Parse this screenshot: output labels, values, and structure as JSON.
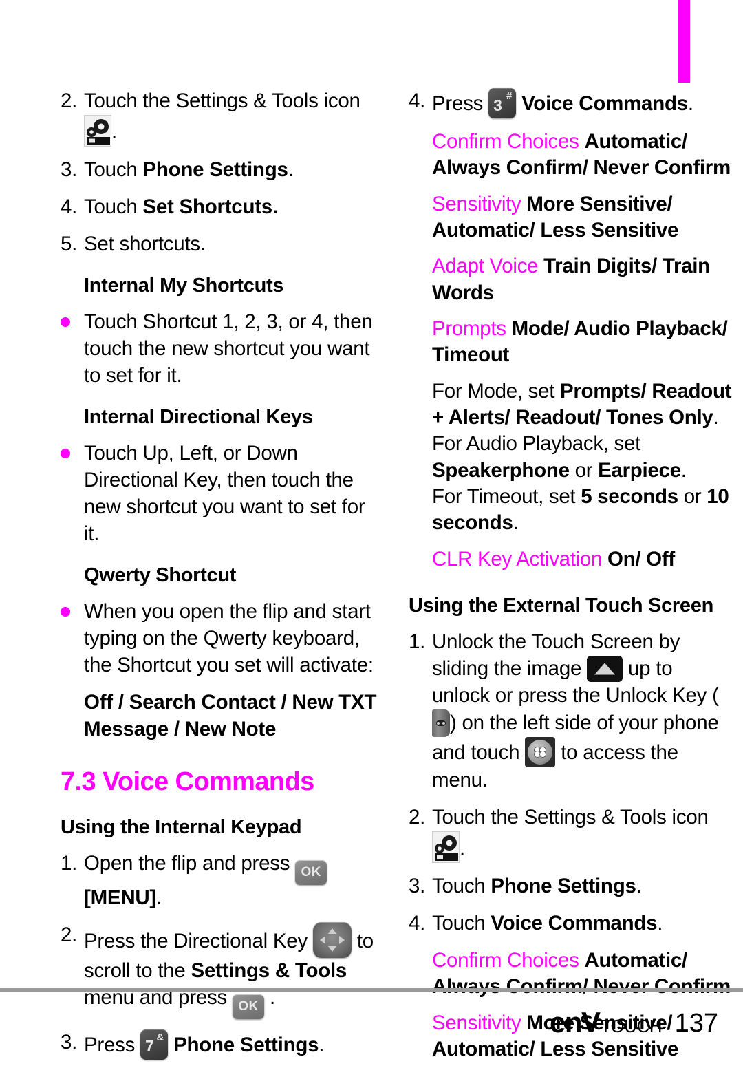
{
  "page": {
    "number": "137",
    "brand_primary": "enV",
    "brand_secondary": "TOUCH",
    "accent_color": "#FF00FF",
    "rule_color": "#9B9B9B"
  },
  "left_column": {
    "steps_top": [
      {
        "num": "2.",
        "pre": "Touch the Settings & Tools icon ",
        "icon": "settings-tools-icon",
        "post": "."
      },
      {
        "num": "3.",
        "pre": "Touch ",
        "bold": "Phone Settings",
        "post": "."
      },
      {
        "num": "4.",
        "pre": "Touch ",
        "bold": "Set Shortcuts.",
        "post": ""
      },
      {
        "num": "5.",
        "pre": "Set shortcuts.",
        "bold": "",
        "post": ""
      }
    ],
    "heading_internal_my_shortcuts": "Internal My Shortcuts",
    "bullet_my_shortcuts": "Touch Shortcut 1, 2, 3, or 4, then touch the new shortcut you want to set for it.",
    "heading_internal_directional_keys": "Internal Directional Keys",
    "bullet_directional_keys": "Touch Up, Left, or Down Directional Key, then touch the new shortcut you want to set for it.",
    "heading_qwerty_shortcut": "Qwerty Shortcut",
    "bullet_qwerty": "When you open the flip and start typing on the Qwerty keyboard, the Shortcut you set will activate:",
    "qwerty_options": "Off / Search Contact / New TXT Message / New Note",
    "section_heading": "7.3 Voice Commands",
    "heading_internal_keypad": "Using the Internal Keypad",
    "keypad_steps": [
      {
        "num": "1.",
        "pre": "Open the flip and press ",
        "icon": "ok-key-icon",
        "post_bold": "[MENU]",
        "post": "."
      },
      {
        "num": "2.",
        "pre": "Press the Directional Key ",
        "icon": "directional-key-icon",
        "mid": " to scroll to the ",
        "bold": "Settings & Tools",
        "mid2": " menu and press ",
        "icon2": "ok-key-icon",
        "post": " ."
      },
      {
        "num": "3.",
        "pre": "Press ",
        "icon": "key-7-icon",
        "key_digit": "7",
        "key_symbol": "&",
        "bold": "Phone Settings",
        "post": "."
      }
    ]
  },
  "right_column": {
    "step_4": {
      "num": "4.",
      "pre": "Press ",
      "key_digit": "3",
      "key_symbol": "#",
      "bold": "Voice Commands",
      "post": "."
    },
    "options": [
      {
        "key": "Confirm Choices",
        "value": "Automatic/ Always Confirm/ Never Confirm"
      },
      {
        "key": "Sensitivity",
        "value": "More Sensitive/ Automatic/ Less Sensitive"
      },
      {
        "key": "Adapt Voice",
        "value": "Train Digits/ Train Words"
      },
      {
        "key": "Prompts",
        "value": "Mode/ Audio Playback/ Timeout"
      }
    ],
    "prompt_detail": [
      {
        "pre": "For Mode, set ",
        "bold": "Prompts/ Readout + Alerts/ Readout/ Tones Only",
        "post": "."
      },
      {
        "pre": "For Audio Playback, set ",
        "bold": "Speakerphone",
        "mid": " or ",
        "bold2": "Earpiece",
        "post": "."
      },
      {
        "pre": "For Timeout, set ",
        "bold": "5 seconds",
        "mid": " or ",
        "bold2": "10 seconds",
        "post": "."
      }
    ],
    "clr_option": {
      "key": "CLR Key Activation",
      "value": "On/ Off"
    },
    "heading_external_touch": "Using the External Touch Screen",
    "touch_steps": [
      {
        "num": "1.",
        "t1": "Unlock the Touch Screen by sliding the image ",
        "icon1": "unlock-slider-icon",
        "t2": " up to unlock or press the Unlock Key (",
        "icon2": "unlock-key-icon",
        "t3": ") on the left side of your phone and touch ",
        "icon3": "menu-dots-icon",
        "t4": " to access the menu."
      },
      {
        "num": "2.",
        "pre": "Touch the Settings & Tools icon ",
        "icon": "settings-tools-icon",
        "post": "."
      },
      {
        "num": "3.",
        "pre": "Touch ",
        "bold": "Phone Settings",
        "post": "."
      },
      {
        "num": "4.",
        "pre": "Touch ",
        "bold": "Voice Commands",
        "post": "."
      }
    ],
    "options_2": [
      {
        "key": "Confirm Choices",
        "value": "Automatic/ Always Confirm/ Never Confirm"
      },
      {
        "key": "Sensitivity",
        "value": "More Sensitive/ Automatic/ Less Sensitive"
      }
    ]
  }
}
